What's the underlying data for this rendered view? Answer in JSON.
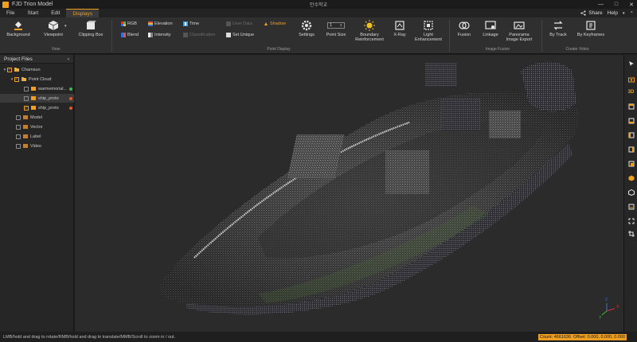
{
  "app": {
    "title": "FJD Trion Model",
    "document_title": "민수학교"
  },
  "window": {
    "min": "—",
    "max": "□",
    "close": "✕"
  },
  "menu": {
    "items": [
      {
        "label": "File",
        "active": false
      },
      {
        "label": "Start",
        "active": false
      },
      {
        "label": "Edit",
        "active": false
      },
      {
        "label": "Displays",
        "active": true
      }
    ],
    "share": "Share",
    "help": "Help"
  },
  "ribbon": {
    "view": {
      "group_label": "View",
      "background": "Background",
      "viewpoint": "Viewpoint",
      "clipping_box": "Clipping Box"
    },
    "point_display": {
      "group_label": "Point Display",
      "rgb": "RGB",
      "blend": "Blend",
      "elevation": "Elevation",
      "intensity": "Intensity",
      "time": "Time",
      "classification": "Classification",
      "user_data": "User Data",
      "set_unique": "Set Unique",
      "shadow": "Shadow",
      "settings": "Settings",
      "point_size": "Point Size",
      "point_size_value": "1",
      "boundary_line1": "Boundary",
      "boundary_line2": "Reinforcement",
      "xray": "X-Ray",
      "light_line1": "Light",
      "light_line2": "Enhancement"
    },
    "image_fusion": {
      "group_label": "Image Fusion",
      "fusion": "Fusion",
      "linkage": "Linkage",
      "panorama_line1": "Panorama",
      "panorama_line2": "Image Export"
    },
    "create_video": {
      "group_label": "Create Video",
      "by_track": "By Track",
      "by_keyframes": "By Keyframes"
    }
  },
  "project_files": {
    "title": "Project Files",
    "collapse": "‹",
    "tree": [
      {
        "label": "Chamsun",
        "level": 0,
        "expanded": true,
        "checked": true,
        "icon": "folder"
      },
      {
        "label": "Point Cloud",
        "level": 1,
        "expanded": true,
        "checked": true,
        "icon": "folder"
      },
      {
        "label": "warmemorial...",
        "level": 2,
        "checked": false,
        "icon": "cloud",
        "dot": "#3fb950",
        "selected": false
      },
      {
        "label": "ship_proto",
        "level": 2,
        "checked": false,
        "icon": "cloud",
        "dot": "#e05a2a",
        "selected": true
      },
      {
        "label": "ship_proto",
        "level": 2,
        "checked": true,
        "icon": "cloud",
        "dot": "#e05a2a",
        "selected": false
      },
      {
        "label": "Model",
        "level": 1,
        "checked": false,
        "icon": "model"
      },
      {
        "label": "Vector",
        "level": 1,
        "checked": false,
        "icon": "vector"
      },
      {
        "label": "Label",
        "level": 1,
        "checked": false,
        "icon": "label"
      },
      {
        "label": "Video",
        "level": 1,
        "checked": false,
        "icon": "video"
      }
    ]
  },
  "right_toolbar": {
    "icons": [
      "cursor-icon",
      "camera-icon",
      "3d-view-icon",
      "top-view-icon",
      "front-view-icon",
      "left-view-icon",
      "side-view-icon",
      "right-view-icon",
      "iso-view-icon",
      "box-view-icon",
      "bottom-view-icon",
      "fit-icon",
      "crop-icon"
    ],
    "label_3d": "3D"
  },
  "axis": {
    "x": "X",
    "y": "Y",
    "z": "Z"
  },
  "status": {
    "hint": "LMB/hold and drag to rotate/RMB/hold and drag to translate/MMB/Scroll to zoom in / out.",
    "count": "Count: 4661636",
    "offset": "Offset: 0.000, 0.000, 0.000"
  },
  "colors": {
    "accent": "#f0a020",
    "panel": "#262626",
    "viewport": "#2b2b2b"
  }
}
